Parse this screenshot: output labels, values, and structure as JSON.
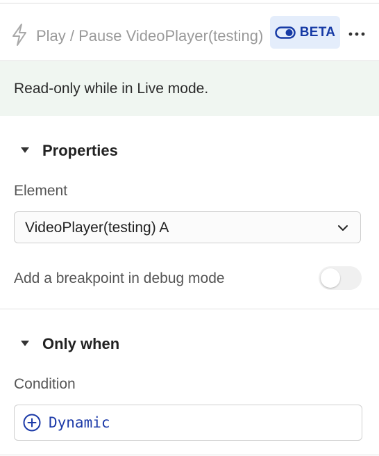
{
  "header": {
    "title": "Play / Pause VideoPlayer(testing)",
    "beta_label": "BETA",
    "bolt_icon": "lightning-bolt-icon",
    "toggle_icon": "toggle-icon",
    "more_icon": "more-horizontal-icon"
  },
  "banner": {
    "text": "Read-only while in Live mode."
  },
  "properties": {
    "heading": "Properties",
    "element_label": "Element",
    "element_value": "VideoPlayer(testing) A",
    "breakpoint_label": "Add a breakpoint in debug mode",
    "breakpoint_on": false
  },
  "only_when": {
    "heading": "Only when",
    "condition_label": "Condition",
    "dynamic_label": "Dynamic"
  },
  "colors": {
    "accent": "#163aa5",
    "beta_bg": "#e4edfb",
    "banner_bg": "#f0f6f1",
    "dynamic_text": "#1c3aa8"
  }
}
